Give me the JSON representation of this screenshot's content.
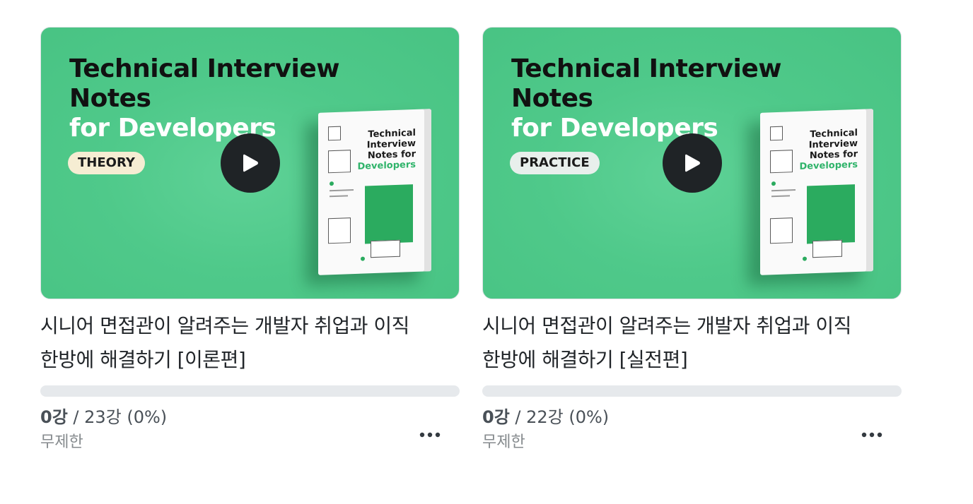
{
  "courses": [
    {
      "thumbnail": {
        "title_line1": "Technical Interview",
        "title_line2": "Notes",
        "title_line3": "for Developers",
        "badge": "THEORY",
        "book_line1": "Technical",
        "book_line2": "Interview",
        "book_line3": "Notes for",
        "book_line4": "Developers"
      },
      "title_line1": "시니어 면접관이 알려주는 개발자 취업과 이직",
      "title_line2": "한방에 해결하기 [이론편]",
      "progress": {
        "done": "0강",
        "rest": " / 23강 (0%)",
        "fraction": 0.0
      },
      "period": "무제한",
      "play_icon": "play-icon",
      "more_icon": "more-icon"
    },
    {
      "thumbnail": {
        "title_line1": "Technical Interview",
        "title_line2": "Notes",
        "title_line3": "for Developers",
        "badge": "PRACTICE",
        "book_line1": "Technical",
        "book_line2": "Interview",
        "book_line3": "Notes for",
        "book_line4": "Developers"
      },
      "title_line1": "시니어 면접관이 알려주는 개발자 취업과 이직",
      "title_line2": "한방에 해결하기 [실전편]",
      "progress": {
        "done": "0강",
        "rest": " / 22강 (0%)",
        "fraction": 0.0
      },
      "period": "무제한",
      "play_icon": "play-icon",
      "more_icon": "more-icon"
    }
  ],
  "colors": {
    "thumbnail_bg": "#4fc98a",
    "progress_track": "#e6e9ec",
    "progress_fill": "#00c471",
    "badge_theory": "#f6edd3",
    "badge_practice": "#e8efec"
  }
}
